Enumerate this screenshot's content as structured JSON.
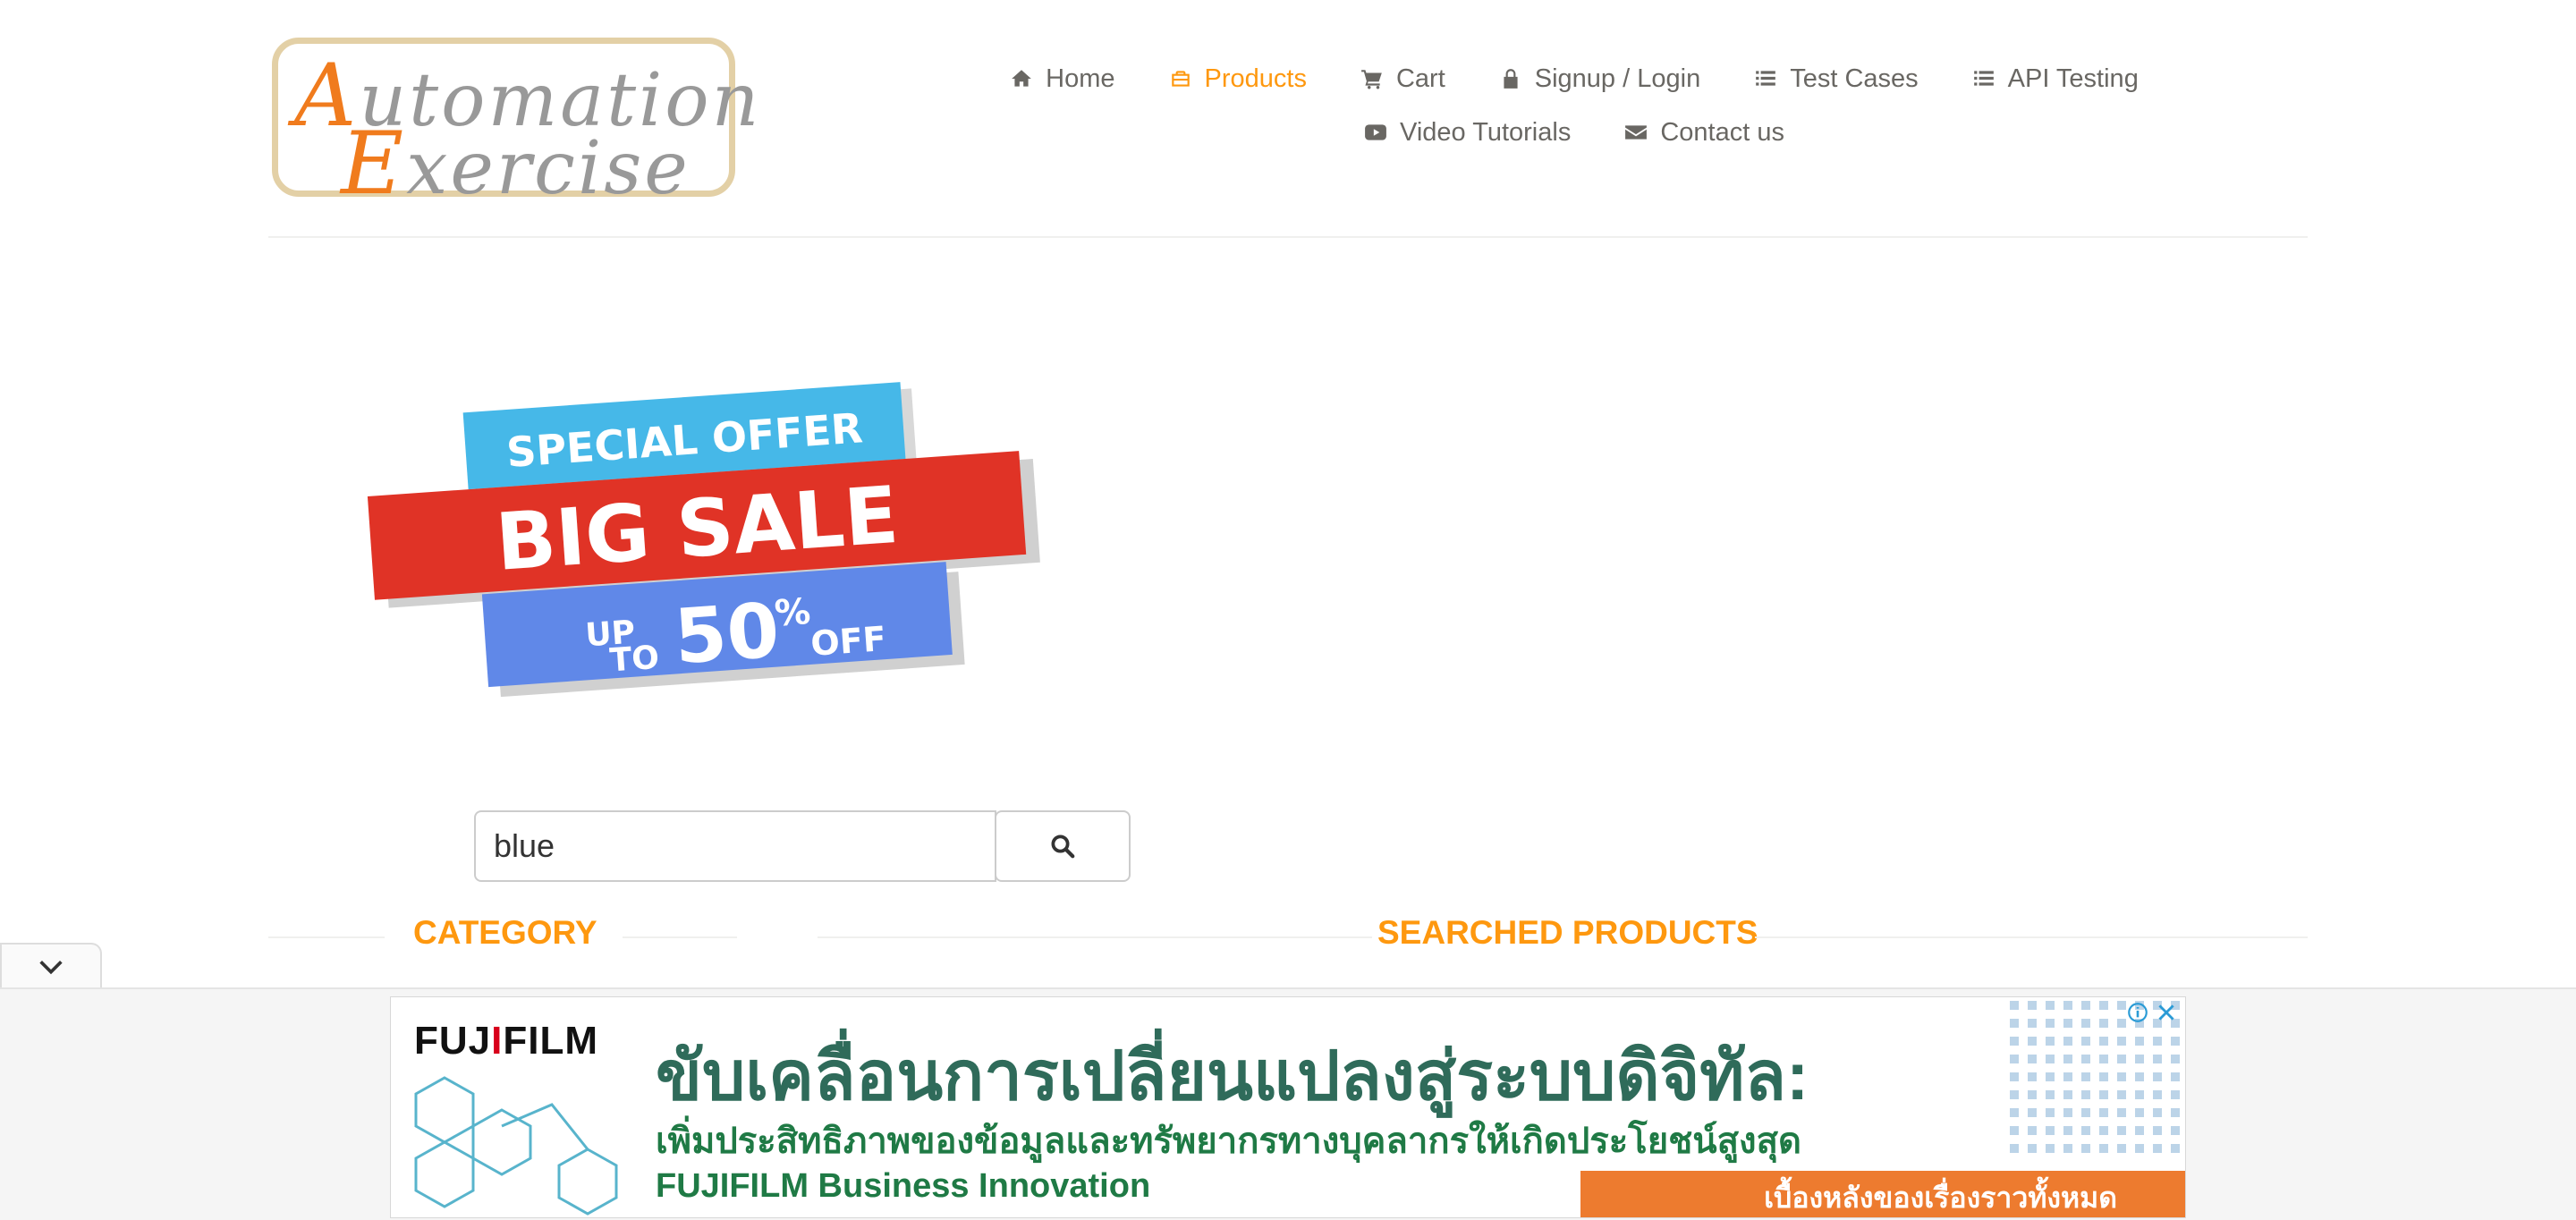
{
  "logo": {
    "line1_cap": "A",
    "line1_rest": "utomation",
    "line2_cap": "E",
    "line2_rest": "xercise"
  },
  "nav": {
    "row1": [
      {
        "label": "Home",
        "icon": "home-icon",
        "active": false
      },
      {
        "label": "Products",
        "icon": "briefcase-icon",
        "active": true
      },
      {
        "label": "Cart",
        "icon": "cart-icon",
        "active": false
      },
      {
        "label": "Signup / Login",
        "icon": "lock-icon",
        "active": false
      },
      {
        "label": "Test Cases",
        "icon": "list-icon",
        "active": false
      },
      {
        "label": "API Testing",
        "icon": "list-icon",
        "active": false
      }
    ],
    "row2": [
      {
        "label": "Video Tutorials",
        "icon": "youtube-icon",
        "active": false
      },
      {
        "label": "Contact us",
        "icon": "envelope-icon",
        "active": false
      }
    ],
    "active_color": "#fe980f"
  },
  "banner": {
    "line1": "SPECIAL OFFER",
    "line2": "BIG SALE",
    "up": "UP",
    "to": "TO",
    "amount": "50",
    "percent": "%",
    "off": "OFF"
  },
  "search": {
    "value": "blue",
    "icon": "search-icon"
  },
  "sections": {
    "category": "CATEGORY",
    "searched": "SEARCHED PRODUCTS"
  },
  "ad": {
    "brand_pre": "FUJ",
    "brand_i": "I",
    "brand_post": "FILM",
    "headline": "ขับเคลื่อนการเปลี่ยนแปลงสู่ระบบดิจิทัล:",
    "subline": "เพิ่มประสิทธิภาพของข้อมูลและทรัพยากรทางบุคลากรให้เกิดประโยชน์สูงสุด",
    "company": "FUJIFILM Business Innovation",
    "cta": "เบื้องหลังของเรื่องราวทั้งหมด"
  }
}
